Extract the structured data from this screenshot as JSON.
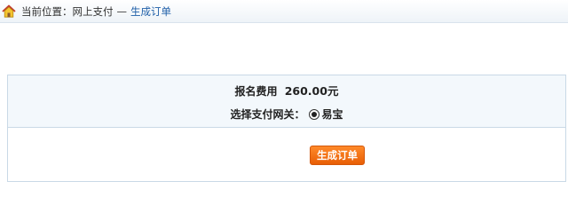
{
  "breadcrumb": {
    "icon": "home-icon",
    "location_label": "当前位置：",
    "parent": "网上支付",
    "separator": "—",
    "current": "生成订单"
  },
  "order": {
    "fee_label": "报名费用",
    "fee_amount": "260.00元",
    "gateway_label": "选择支付网关：",
    "gateway_option": "易宝",
    "gateway_selected": true
  },
  "actions": {
    "submit_label": "生成订单"
  },
  "colors": {
    "accent_link": "#1f5fa8",
    "button": "#f07010",
    "panel_bg": "#f3f8fc"
  }
}
